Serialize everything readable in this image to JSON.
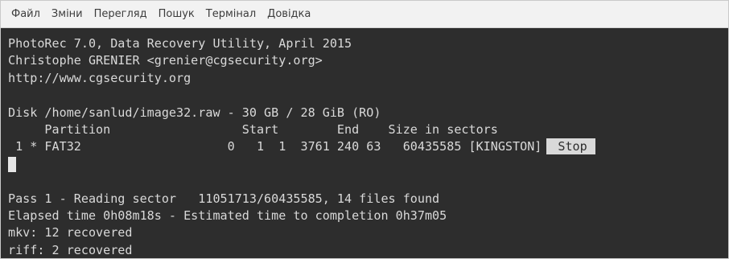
{
  "menu": {
    "items": [
      {
        "label": "Файл"
      },
      {
        "label": "Зміни"
      },
      {
        "label": "Перегляд"
      },
      {
        "label": "Пошук"
      },
      {
        "label": "Термінал"
      },
      {
        "label": "Довідка"
      }
    ]
  },
  "terminal": {
    "header_line1": "PhotoRec 7.0, Data Recovery Utility, April 2015",
    "header_line2": "Christophe GRENIER <grenier@cgsecurity.org>",
    "header_line3": "http://www.cgsecurity.org",
    "disk_line": "Disk /home/sanlud/image32.raw - 30 GB / 28 GiB (RO)",
    "columns_line": "     Partition                  Start        End    Size in sectors",
    "partition_line": " 1 * FAT32                    0   1  1  3761 240 63   60435585 [KINGSTON]",
    "stop_label": "Stop",
    "pass_line": "Pass 1 - Reading sector   11051713/60435585, 14 files found",
    "elapsed_line": "Elapsed time 0h08m18s - Estimated time to completion 0h37m05",
    "recovered": [
      "mkv: 12 recovered",
      "riff: 2 recovered"
    ]
  }
}
